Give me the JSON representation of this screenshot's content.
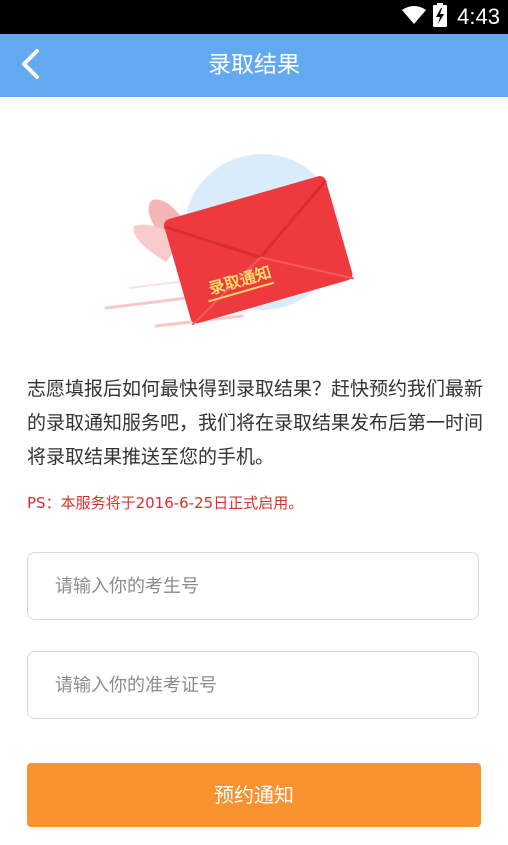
{
  "status_bar": {
    "time": "4:43",
    "icons": [
      "wifi-icon",
      "battery-charging-icon"
    ]
  },
  "header": {
    "title": "录取结果",
    "back_icon": "chevron-left-icon",
    "background_color": "#63a9f2"
  },
  "illustration": {
    "envelope_label": "录取通知",
    "envelope_color": "#ee3a3e",
    "circle_color": "#d9ecfb"
  },
  "main": {
    "description": "志愿填报后如何最快得到录取结果？赶快预约我们最新的录取通知服务吧，我们将在录取结果发布后第一时间将录取结果推送至您的手机。",
    "ps_note": "PS：本服务将于2016-6-25日正式启用。",
    "inputs": [
      {
        "placeholder": "请输入你的考生号",
        "value": ""
      },
      {
        "placeholder": "请输入你的准考证号",
        "value": ""
      }
    ],
    "submit_label": "预约通知",
    "submit_color": "#fb9230",
    "ps_color": "#d9302c"
  }
}
